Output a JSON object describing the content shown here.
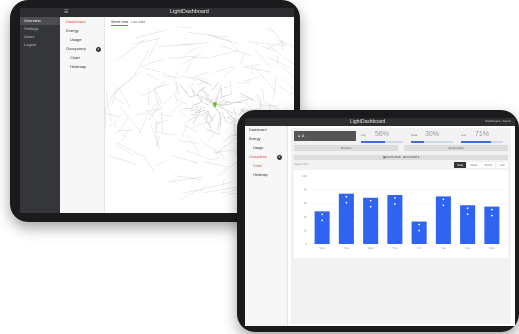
{
  "tablet1": {
    "title": "LightDashboard",
    "top_menu": "☰",
    "sidebar": [
      "Overview",
      "Settings",
      "Users",
      "Logout"
    ],
    "nav": [
      {
        "label": "Dashboard",
        "style": "red"
      },
      {
        "label": "Energy",
        "style": "normal"
      },
      {
        "label": "Usage",
        "style": "sub"
      },
      {
        "label": "Occupancy",
        "style": "normal",
        "badge": "6"
      },
      {
        "label": "Chart",
        "style": "sub"
      },
      {
        "label": "Heatmap",
        "style": "sub"
      }
    ],
    "tabs": [
      "Street view",
      "Live data"
    ],
    "colors": {
      "marker": "#7bb33a",
      "roads": "#c8c8c8"
    }
  },
  "tablet2": {
    "title": "LightDashboard",
    "top_right": "Dashboard • Admin",
    "nav": [
      {
        "label": "Dashboard",
        "style": "normal"
      },
      {
        "label": "Energy",
        "style": "normal"
      },
      {
        "label": "Usage",
        "style": "sub"
      },
      {
        "label": "Occupancy",
        "style": "red",
        "badge": "6"
      },
      {
        "label": "Chart",
        "style": "sub"
      },
      {
        "label": "Heatmap",
        "style": "sub"
      }
    ],
    "kpi_dark": "● 11",
    "kpis": [
      {
        "label": "Avg",
        "value": "56%",
        "fill": 0.56
      },
      {
        "label": "Peak",
        "value": "30%",
        "fill": 0.3
      },
      {
        "label": "Low",
        "value": "71%",
        "fill": 0.71
      }
    ],
    "buttons": [
      "All floors",
      "Ground floor"
    ],
    "date_range": "▦ 03.03.2018 - 08.03.2018 ▾",
    "filter_placeholder": "Search floor",
    "view_tabs": [
      "Daily",
      "Week",
      "Month",
      "Year"
    ],
    "active_view_tab": "Daily",
    "colors": {
      "bar": "#2f63f2",
      "accent": "#e74c3c"
    }
  },
  "chart_data": {
    "type": "bar",
    "categories": [
      "Mon",
      "Tue",
      "Wed",
      "Thu",
      "Fri",
      "Sat",
      "Sun",
      "Mon"
    ],
    "values": [
      48,
      74,
      68,
      72,
      33,
      70,
      57,
      55
    ],
    "ylim": [
      0,
      100
    ],
    "yticks": [
      0,
      20,
      40,
      60,
      80,
      100
    ],
    "grid": true
  }
}
